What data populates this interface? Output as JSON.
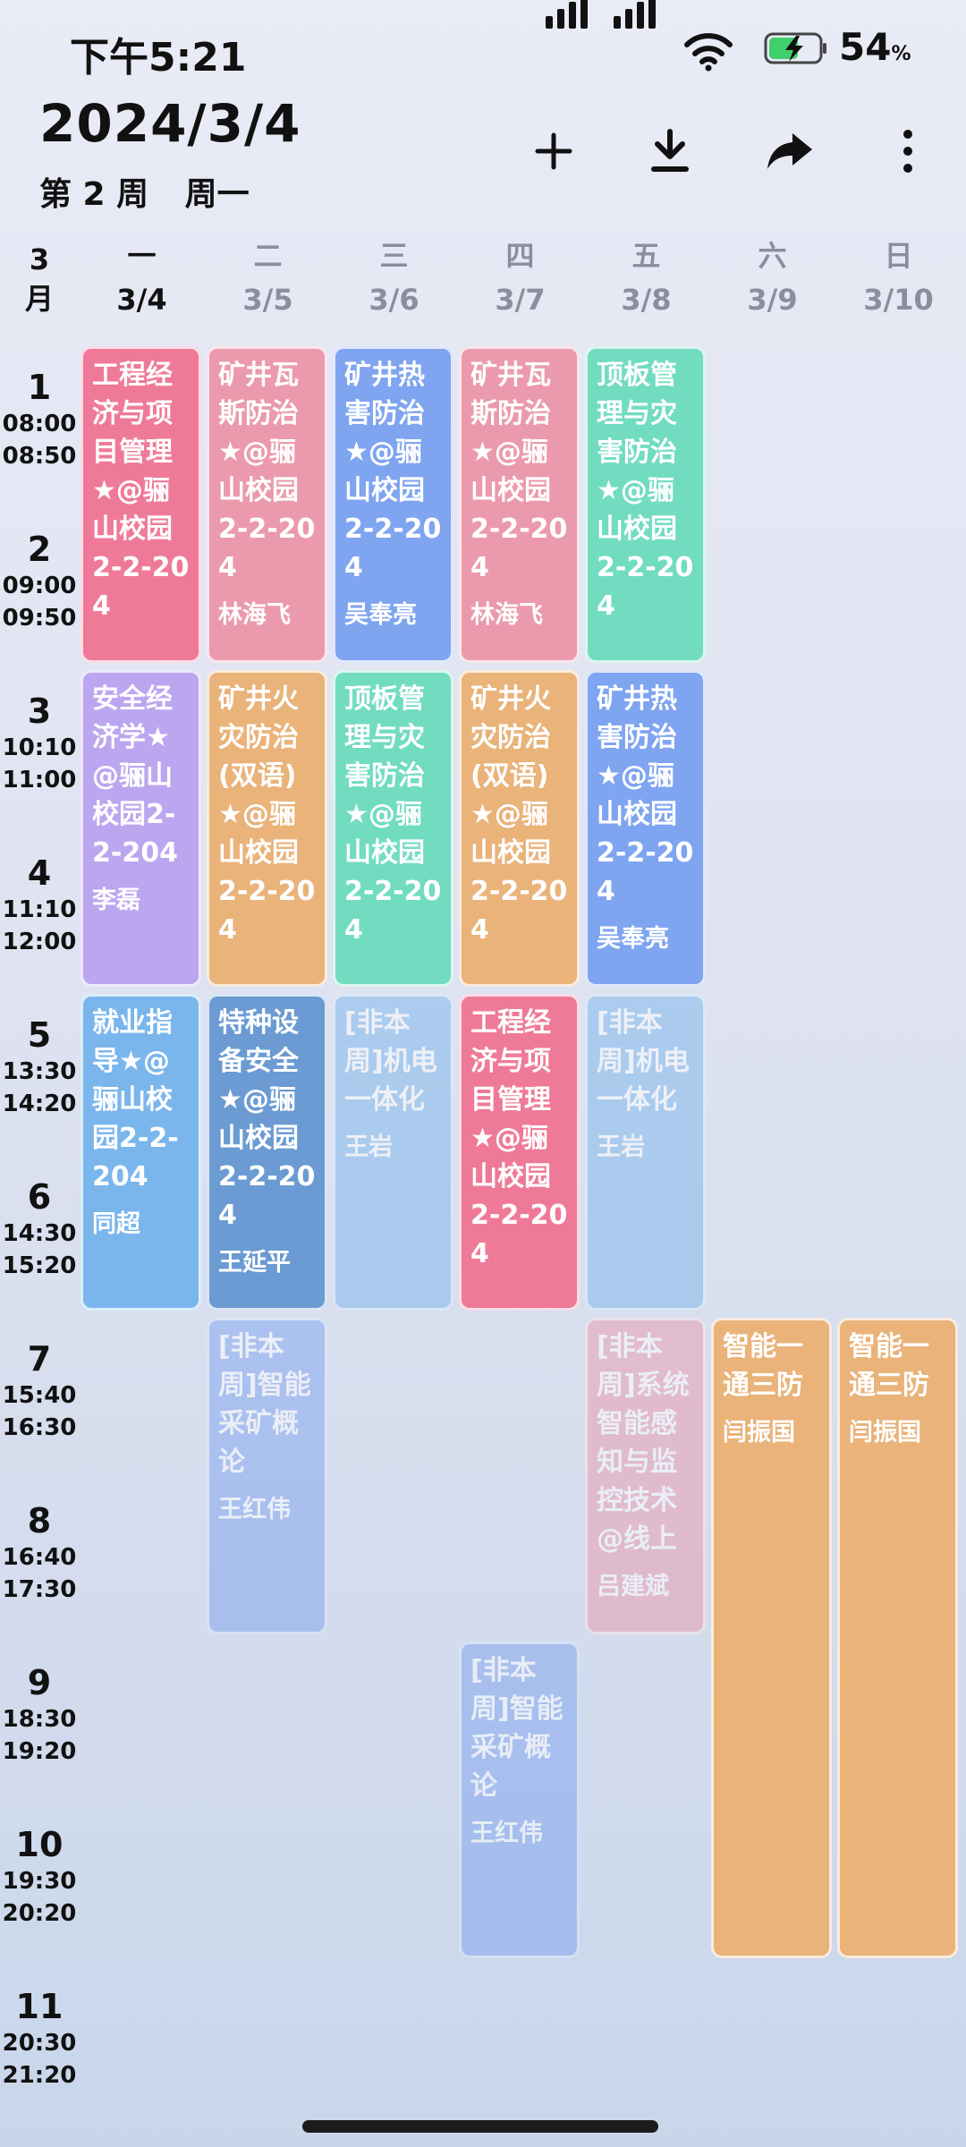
{
  "status_bar": {
    "time": "下午5:21",
    "battery": "54",
    "battery_unit": "%"
  },
  "header": {
    "date": "2024/3/4",
    "week": "第 2 周",
    "weekday": "周一"
  },
  "toolbar": {
    "add_icon": "plus-icon",
    "download_icon": "download-icon",
    "share_icon": "share-arrow-icon",
    "more_icon": "more-vertical-icon"
  },
  "month": {
    "num": "3",
    "label": "月"
  },
  "days": [
    {
      "wd": "一",
      "date": "3/4"
    },
    {
      "wd": "二",
      "date": "3/5"
    },
    {
      "wd": "三",
      "date": "3/6"
    },
    {
      "wd": "四",
      "date": "3/7"
    },
    {
      "wd": "五",
      "date": "3/8"
    },
    {
      "wd": "六",
      "date": "3/9"
    },
    {
      "wd": "日",
      "date": "3/10"
    }
  ],
  "periods": [
    {
      "num": "1",
      "start": "08:00",
      "end": "08:50"
    },
    {
      "num": "2",
      "start": "09:00",
      "end": "09:50"
    },
    {
      "num": "3",
      "start": "10:10",
      "end": "11:00"
    },
    {
      "num": "4",
      "start": "11:10",
      "end": "12:00"
    },
    {
      "num": "5",
      "start": "13:30",
      "end": "14:20"
    },
    {
      "num": "6",
      "start": "14:30",
      "end": "15:20"
    },
    {
      "num": "7",
      "start": "15:40",
      "end": "16:30"
    },
    {
      "num": "8",
      "start": "16:40",
      "end": "17:30"
    },
    {
      "num": "9",
      "start": "18:30",
      "end": "19:20"
    },
    {
      "num": "10",
      "start": "19:30",
      "end": "20:20"
    },
    {
      "num": "11",
      "start": "20:30",
      "end": "21:20"
    }
  ],
  "courses": [
    {
      "day": 0,
      "start": 1,
      "span": 2,
      "color": "#ef7a98",
      "ghost": false,
      "text": "工程经济与项目管理★@骊山校园2-2-204",
      "extra": ""
    },
    {
      "day": 1,
      "start": 1,
      "span": 2,
      "color": "#eb9aad",
      "ghost": false,
      "text": "矿井瓦斯防治★@骊山校园2-2-204",
      "extra": "林海飞"
    },
    {
      "day": 2,
      "start": 1,
      "span": 2,
      "color": "#7fa4f0",
      "ghost": false,
      "text": "矿井热害防治★@骊山校园2-2-204",
      "extra": "吴奉亮"
    },
    {
      "day": 3,
      "start": 1,
      "span": 2,
      "color": "#eb9aad",
      "ghost": false,
      "text": "矿井瓦斯防治★@骊山校园2-2-204",
      "extra": "林海飞"
    },
    {
      "day": 4,
      "start": 1,
      "span": 2,
      "color": "#72dcc1",
      "ghost": false,
      "text": "顶板管理与灾害防治★@骊山校园2-2-204",
      "extra": ""
    },
    {
      "day": 0,
      "start": 3,
      "span": 2,
      "color": "#bca6ef",
      "ghost": false,
      "text": "安全经济学★@骊山校园2-2-204",
      "extra": "李磊"
    },
    {
      "day": 1,
      "start": 3,
      "span": 2,
      "color": "#e9b37a",
      "ghost": false,
      "text": "矿井火灾防治(双语)★@骊山校园2-2-204",
      "extra": ""
    },
    {
      "day": 2,
      "start": 3,
      "span": 2,
      "color": "#72dcc1",
      "ghost": false,
      "text": "顶板管理与灾害防治★@骊山校园2-2-204",
      "extra": ""
    },
    {
      "day": 3,
      "start": 3,
      "span": 2,
      "color": "#e9b37a",
      "ghost": false,
      "text": "矿井火灾防治(双语)★@骊山校园2-2-204",
      "extra": ""
    },
    {
      "day": 4,
      "start": 3,
      "span": 2,
      "color": "#7fa4f0",
      "ghost": false,
      "text": "矿井热害防治★@骊山校园2-2-204",
      "extra": "吴奉亮"
    },
    {
      "day": 0,
      "start": 5,
      "span": 2,
      "color": "#7ab6ec",
      "ghost": false,
      "text": "就业指导★@骊山校园2-2-204",
      "extra": "同超"
    },
    {
      "day": 1,
      "start": 5,
      "span": 2,
      "color": "#6b9bd2",
      "ghost": false,
      "text": "特种设备安全★@骊山校园2-2-204",
      "extra": "王延平"
    },
    {
      "day": 2,
      "start": 5,
      "span": 2,
      "color": "#7ab6ec",
      "ghost": true,
      "text": "[非本周]机电一体化",
      "extra": "王岩"
    },
    {
      "day": 3,
      "start": 5,
      "span": 2,
      "color": "#ef7a98",
      "ghost": false,
      "text": "工程经济与项目管理★@骊山校园2-2-204",
      "extra": ""
    },
    {
      "day": 4,
      "start": 5,
      "span": 2,
      "color": "#7ab6ec",
      "ghost": true,
      "text": "[非本周]机电一体化",
      "extra": "王岩"
    },
    {
      "day": 1,
      "start": 7,
      "span": 2,
      "color": "#7fa4f0",
      "ghost": true,
      "text": "[非本周]智能采矿概论",
      "extra": "王红伟"
    },
    {
      "day": 4,
      "start": 7,
      "span": 2,
      "color": "#eb9aad",
      "ghost": true,
      "text": "[非本周]系统智能感知与监控技术@线上",
      "extra": "吕建斌"
    },
    {
      "day": 5,
      "start": 7,
      "span": 4,
      "color": "#e9b37a",
      "ghost": false,
      "text": "智能一通三防",
      "extra": "闫振国"
    },
    {
      "day": 6,
      "start": 7,
      "span": 4,
      "color": "#e9b37a",
      "ghost": false,
      "text": "智能一通三防",
      "extra": "闫振国"
    },
    {
      "day": 3,
      "start": 9,
      "span": 2,
      "color": "#7fa4f0",
      "ghost": true,
      "text": "[非本周]智能采矿概论",
      "extra": "王红伟"
    }
  ]
}
